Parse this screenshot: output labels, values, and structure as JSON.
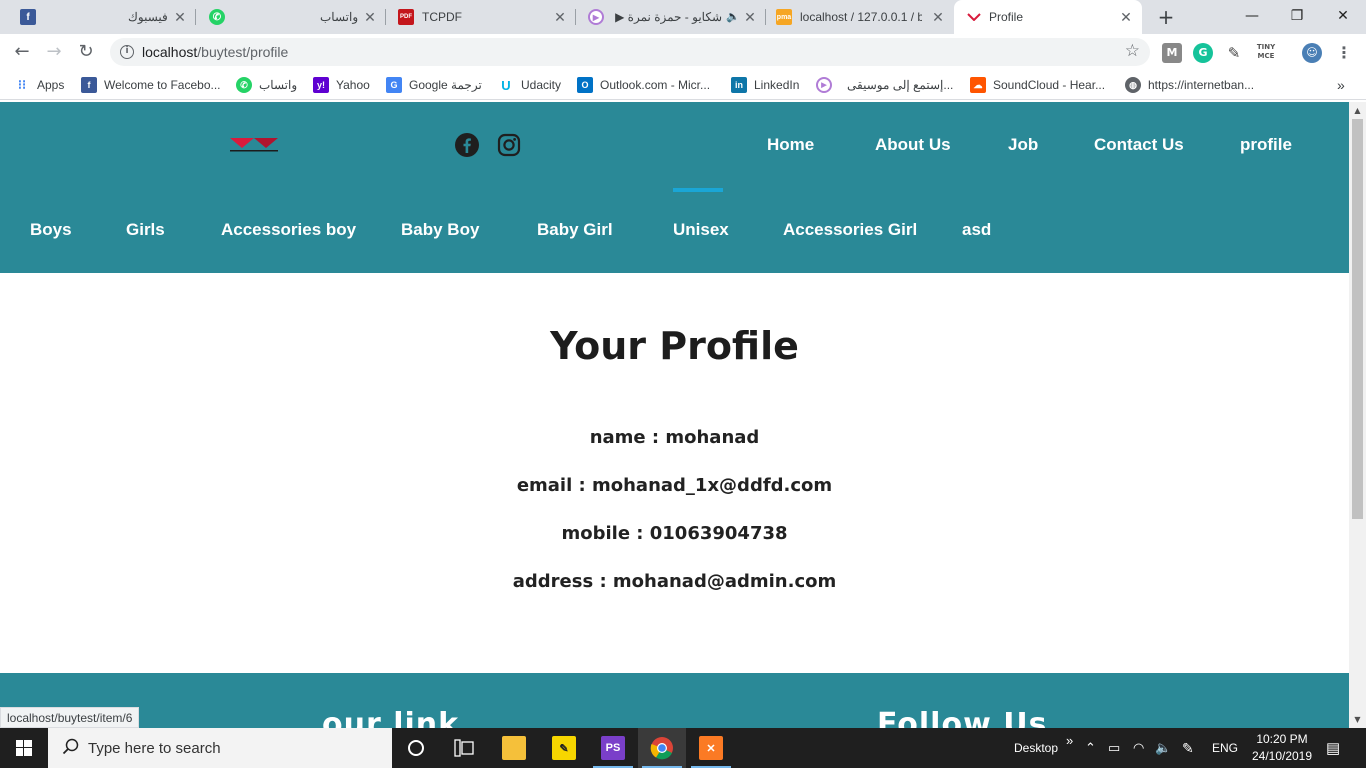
{
  "browser": {
    "tabs": [
      {
        "title": "فيسبوك",
        "icon": "facebook-icon"
      },
      {
        "title": "واتساب",
        "icon": "whatsapp-icon"
      },
      {
        "title": "TCPDF",
        "icon": "pdf-icon"
      },
      {
        "title": "شكايو - حمزة نمرة ▶",
        "icon": "music-icon"
      },
      {
        "title": "localhost / 127.0.0.1 / b",
        "icon": "phpmyadmin-icon"
      },
      {
        "title": "Profile",
        "icon": "site-logo-icon"
      }
    ],
    "url_host": "localhost",
    "url_path": "/buytest/profile",
    "bookmarks": [
      {
        "label": "Apps"
      },
      {
        "label": "Welcome to Facebo..."
      },
      {
        "label": "واتساب"
      },
      {
        "label": "Yahoo"
      },
      {
        "label": "Google ترجمة"
      },
      {
        "label": "Udacity"
      },
      {
        "label": "Outlook.com - Micr..."
      },
      {
        "label": "LinkedIn"
      },
      {
        "label": "إستمع إلى موسيقى..."
      },
      {
        "label": "SoundCloud - Hear..."
      },
      {
        "label": "https://internetban..."
      }
    ],
    "status_url": "localhost/buytest/item/6"
  },
  "site": {
    "main_nav": [
      "Home",
      "About Us",
      "Job",
      "Contact Us",
      "profile"
    ],
    "categories": [
      "Boys",
      "Girls",
      "Accessories boy",
      "Baby Boy",
      "Baby Girl",
      "Unisex",
      "Accessories Girl",
      "asd"
    ],
    "active_category": "Unisex",
    "colors": {
      "header_bg": "#2a8997",
      "active_underline": "#1aa6d6",
      "text": "#ffffff"
    }
  },
  "profile": {
    "title": "Your Profile",
    "name": "name : mohanad",
    "email": "email : mohanad_1x@ddfd.com",
    "mobile": "mobile : 01063904738",
    "address": "address : mohanad@admin.com"
  },
  "footer": {
    "links_heading": "our link",
    "follow_heading": "Follow Us"
  },
  "taskbar": {
    "search_placeholder": "Type here to search",
    "desktop_label": "Desktop",
    "language": "ENG",
    "time": "10:20 PM",
    "date": "24/10/2019"
  }
}
